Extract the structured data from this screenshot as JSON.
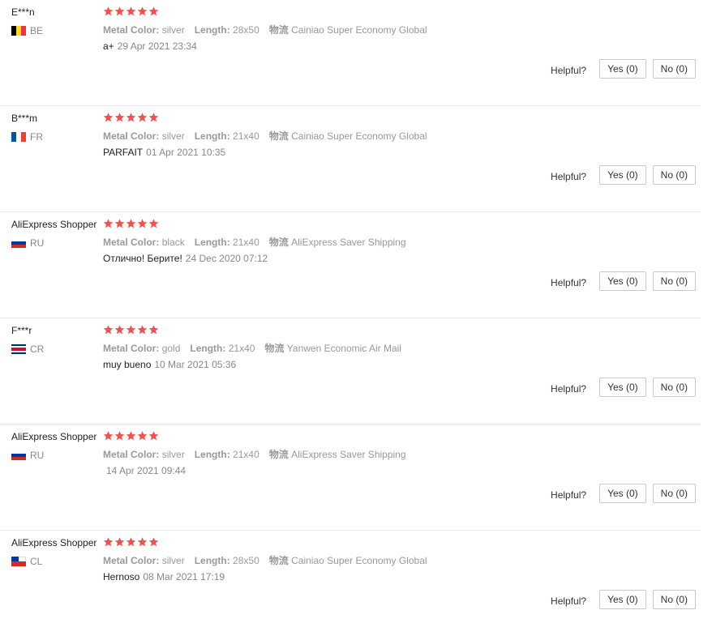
{
  "labels": {
    "metal_color": "Metal Color:",
    "length": "Length:",
    "shipping": "物流",
    "helpful": "Helpful?"
  },
  "colors": {
    "star": "#f0524f",
    "muted": "#999999"
  },
  "reviews": [
    {
      "user": "E***n",
      "country_code": "BE",
      "flag_colors": [
        "#000000",
        "#fdda24",
        "#ef3340"
      ],
      "rating": 5,
      "metal_color": "silver",
      "length": "28x50",
      "shipping": "Cainiao Super Economy Global",
      "text": "a+",
      "date": "29 Apr 2021 23:34",
      "yes": "Yes (0)",
      "no": "No (0)"
    },
    {
      "user": "B***m",
      "country_code": "FR",
      "flag_colors": [
        "#0055a4",
        "#ffffff",
        "#ef4135"
      ],
      "rating": 5,
      "metal_color": "silver",
      "length": "21x40",
      "shipping": "Cainiao Super Economy Global",
      "text": "PARFAIT",
      "date": "01 Apr 2021 10:35",
      "yes": "Yes (0)",
      "no": "No (0)"
    },
    {
      "user": "AliExpress Shopper",
      "country_code": "RU",
      "flag_colors": [
        "#ffffff",
        "#0039a6",
        "#d52b1e"
      ],
      "rating": 5,
      "metal_color": "black",
      "length": "21x40",
      "shipping": "AliExpress Saver Shipping",
      "text": "Отлично! Берите!",
      "date": "24 Dec 2020 07:12",
      "yes": "Yes (0)",
      "no": "No (0)"
    },
    {
      "user": "F***r",
      "country_code": "CR",
      "flag_colors": [
        "#002b7f",
        "#ffffff",
        "#ce1126",
        "#ffffff",
        "#002b7f"
      ],
      "rating": 5,
      "metal_color": "gold",
      "length": "21x40",
      "shipping": "Yanwen Economic Air Mail",
      "text": "muy bueno",
      "date": "10 Mar 2021 05:36",
      "yes": "Yes (0)",
      "no": "No (0)"
    },
    {
      "user": "AliExpress Shopper",
      "country_code": "RU",
      "flag_colors": [
        "#ffffff",
        "#0039a6",
        "#d52b1e"
      ],
      "rating": 5,
      "metal_color": "silver",
      "length": "21x40",
      "shipping": "AliExpress Saver Shipping",
      "text": "",
      "date": "14 Apr 2021 09:44",
      "yes": "Yes (0)",
      "no": "No (0)"
    },
    {
      "user": "AliExpress Shopper",
      "country_code": "CL",
      "flag_colors": [
        "#0039a6",
        "#ffffff",
        "#d52b1e"
      ],
      "rating": 5,
      "metal_color": "silver",
      "length": "28x50",
      "shipping": "Cainiao Super Economy Global",
      "text": "Hernoso",
      "date": "08 Mar 2021 17:19",
      "yes": "Yes (0)",
      "no": "No (0)"
    }
  ]
}
